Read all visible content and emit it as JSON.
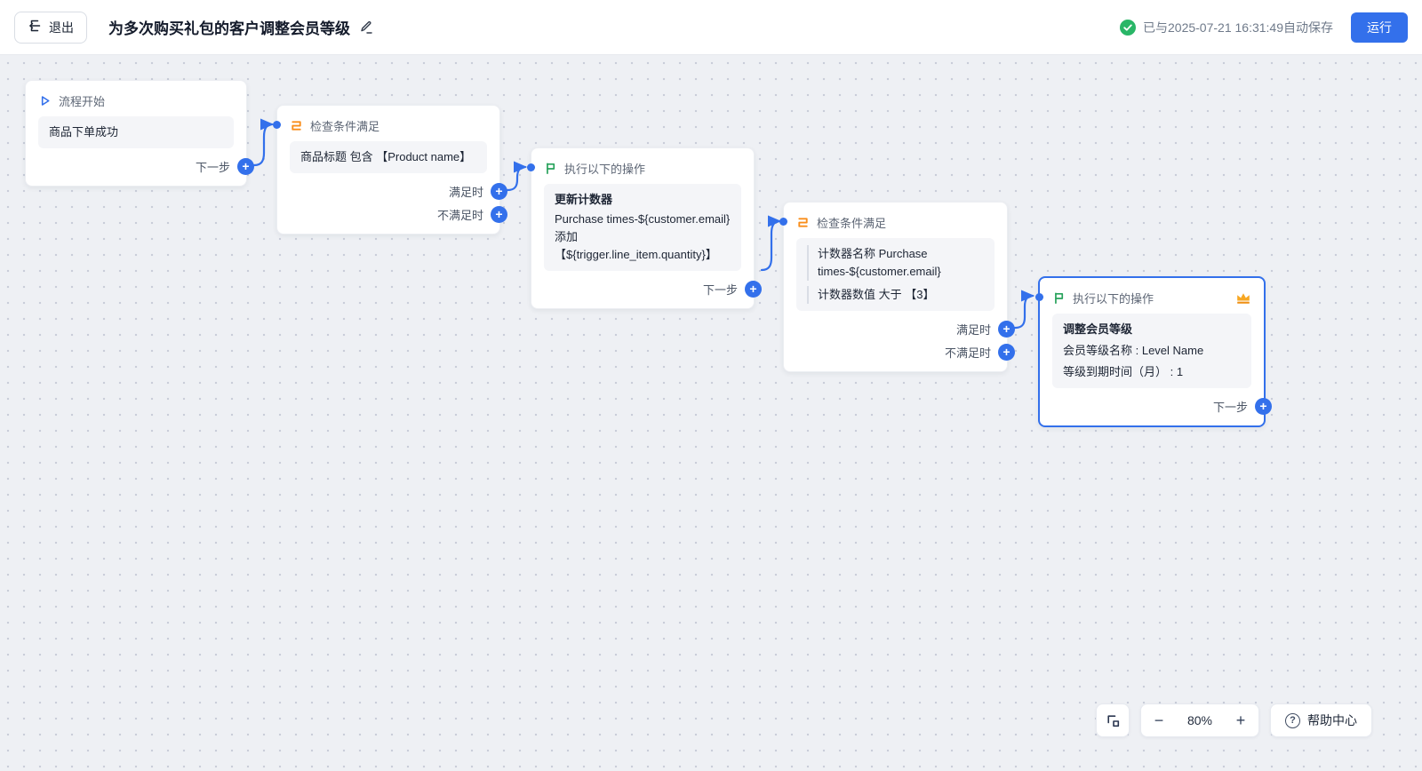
{
  "topbar": {
    "exit_label": "退出",
    "title": "为多次购买礼包的客户调整会员等级",
    "autosave_status": "已与2025-07-21 16:31:49自动保存",
    "run_label": "运行"
  },
  "nodes": {
    "start": {
      "title": "流程开始",
      "body": "商品下单成功",
      "next_label": "下一步"
    },
    "condition1": {
      "title": "检查条件满足",
      "body": "商品标题 包含 【Product name】",
      "met_label": "满足时",
      "not_met_label": "不满足时"
    },
    "action1": {
      "title": "执行以下的操作",
      "action_name": "更新计数器",
      "action_detail": "Purchase times-${customer.email} 添加【${trigger.line_item.quantity}】",
      "next_label": "下一步"
    },
    "condition2": {
      "title": "检查条件满足",
      "condition_lines": [
        "计数器名称 Purchase times-${customer.email}",
        "计数器数值 大于 【3】"
      ],
      "met_label": "满足时",
      "not_met_label": "不满足时"
    },
    "action2": {
      "title": "执行以下的操作",
      "action_name": "调整会员等级",
      "detail_lines": [
        "会员等级名称 : Level Name",
        "等级到期时间（月） : 1"
      ],
      "next_label": "下一步"
    }
  },
  "controls": {
    "zoom_level": "80%",
    "help_label": "帮助中心"
  },
  "icons": {
    "plus": "+",
    "minus": "−",
    "question": "?"
  },
  "colors": {
    "accent_blue": "#3370eb",
    "success_green": "#29b667",
    "flag_green": "#27a25b",
    "condition_orange": "#f98e1b",
    "crown_gold": "#f7a723",
    "canvas_bg": "#eef0f4"
  }
}
